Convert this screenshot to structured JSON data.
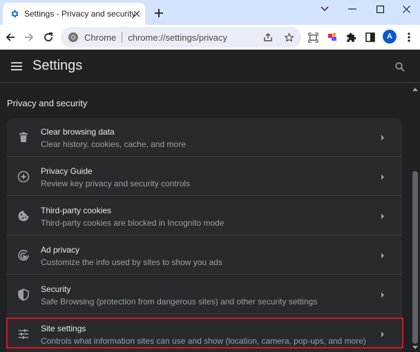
{
  "colors": {
    "tabstrip_bg": "#d3e3fd",
    "page_bg": "#202124",
    "card_bg": "#292a2d",
    "highlight_border": "#e0141e",
    "avatar_bg": "#0b57d0"
  },
  "browser": {
    "tab": {
      "title": "Settings - Privacy and security",
      "favicon": "settings-gear-icon"
    },
    "omnibox": {
      "site_label": "Chrome",
      "url": "chrome://settings/privacy"
    },
    "profile_initial": "A"
  },
  "header": {
    "title": "Settings"
  },
  "section": {
    "title": "Privacy and security"
  },
  "items": [
    {
      "title": "Clear browsing data",
      "subtitle": "Clear history, cookies, cache, and more",
      "icon": "trash-icon"
    },
    {
      "title": "Privacy Guide",
      "subtitle": "Review key privacy and security controls",
      "icon": "compass-icon"
    },
    {
      "title": "Third-party cookies",
      "subtitle": "Third-party cookies are blocked in Incognito mode",
      "icon": "cookie-icon"
    },
    {
      "title": "Ad privacy",
      "subtitle": "Customize the info used by sites to show you ads",
      "icon": "ad-privacy-icon"
    },
    {
      "title": "Security",
      "subtitle": "Safe Browsing (protection from dangerous sites) and other security settings",
      "icon": "shield-icon"
    },
    {
      "title": "Site settings",
      "subtitle": "Controls what information sites can use and show (location, camera, pop-ups, and more)",
      "icon": "sliders-icon",
      "highlighted": true
    }
  ]
}
